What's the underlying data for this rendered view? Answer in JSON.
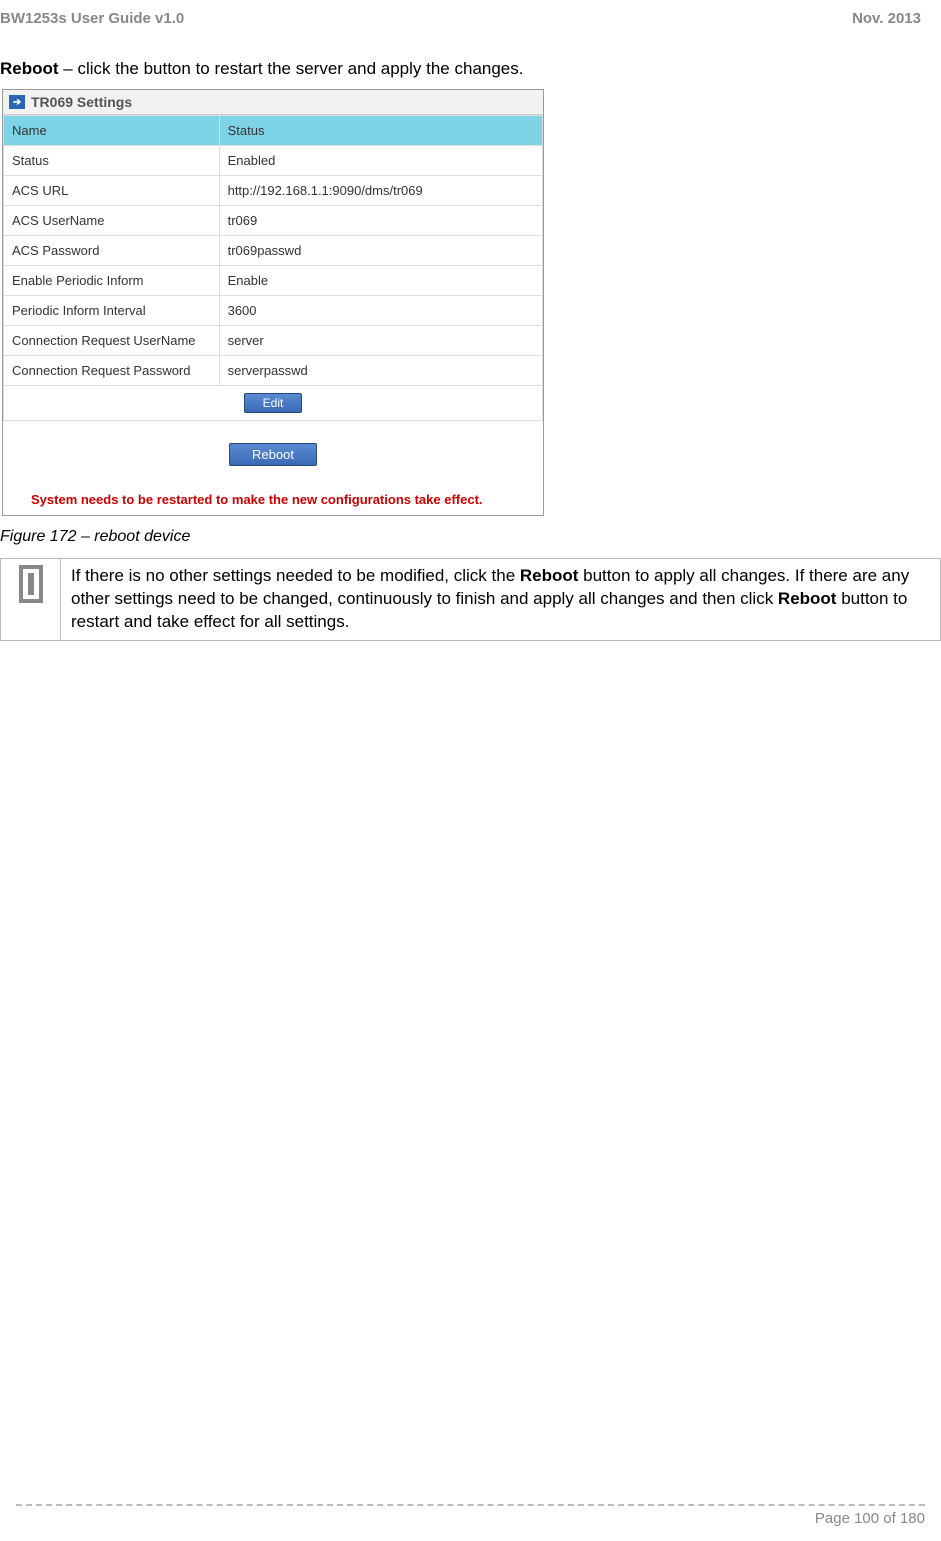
{
  "header": {
    "left": "BW1253s User Guide v1.0",
    "right": "Nov.  2013"
  },
  "paragraph": {
    "bold": "Reboot",
    "rest": " – click the button to restart the server and apply the changes."
  },
  "panel": {
    "title": "TR069 Settings",
    "columns": {
      "name": "Name",
      "status": "Status"
    },
    "rows": [
      {
        "label": "Status",
        "value": "Enabled"
      },
      {
        "label": "ACS URL",
        "value": "http://192.168.1.1:9090/dms/tr069"
      },
      {
        "label": "ACS UserName",
        "value": "tr069"
      },
      {
        "label": "ACS Password",
        "value": "tr069passwd"
      },
      {
        "label": "Enable Periodic Inform",
        "value": "Enable"
      },
      {
        "label": "Periodic Inform Interval",
        "value": "3600"
      },
      {
        "label": "Connection Request UserName",
        "value": "server"
      },
      {
        "label": "Connection Request Password",
        "value": "serverpasswd"
      }
    ],
    "edit_button": "Edit",
    "reboot_button": "Reboot",
    "warning": "System needs to be restarted to make the new configurations take effect."
  },
  "caption": "Figure 172 – reboot device",
  "note": {
    "part1": "If there is no other settings needed to be modified, click the ",
    "bold1": "Reboot",
    "part2": " button to apply all changes. If there are any other settings need to be changed, continuously to finish and apply all changes and then click ",
    "bold2": "Reboot",
    "part3": " button to restart and take effect  for all settings."
  },
  "footer": "Page 100 of 180"
}
